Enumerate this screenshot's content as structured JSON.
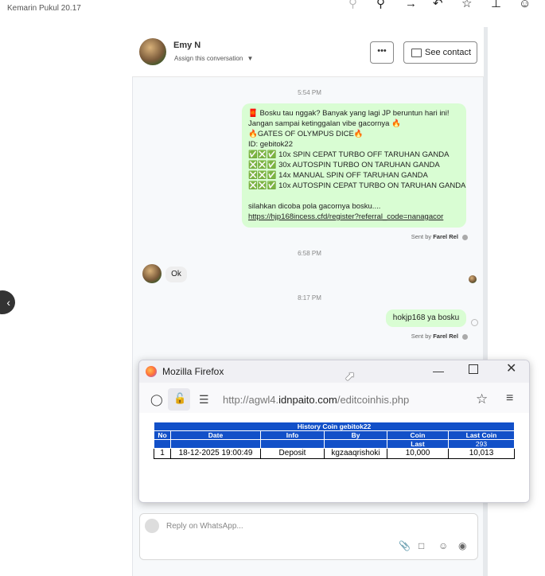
{
  "top_bar": {
    "timestamp": "Kemarin Pukul 20.17",
    "icons": [
      "zoom-out-icon",
      "zoom-in-icon",
      "forward-icon",
      "reply-icon",
      "star-icon",
      "pin-icon",
      "emoji-icon"
    ]
  },
  "conversation_header": {
    "contact_name": "Emy N",
    "assign_label": "Assign this conversation",
    "more_label": "•••",
    "see_contact_label": "See contact"
  },
  "messages": {
    "time1": "5:54 PM",
    "promo": {
      "lines": [
        "🧧 Bosku tau nggak? Banyak yang lagi JP beruntun hari ini!",
        "Jangan sampai ketinggalan vibe gacornya 🔥",
        "🔥GATES OF OLYMPUS DICE🔥",
        "ID: gebitok22",
        "✅❎✅ 10x SPIN CEPAT TURBO OFF TARUHAN GANDA",
        "❎❎✅ 30x AUTOSPIN TURBO ON TARUHAN GANDA",
        "❎❎✅ 14x MANUAL SPIN OFF TARUHAN GANDA",
        "❎❎✅ 10x AUTOSPIN CEPAT TURBO ON TARUHAN GANDA",
        "",
        "silahkan dicoba pola gacornya bosku....",
        "https://hjp168incess.cfd/register?referral_code=nanagacor"
      ],
      "sent_prefix": "Sent by",
      "sent_by": "Farel Rel"
    },
    "time2": "6:58 PM",
    "incoming": "Ok",
    "time3": "8:17 PM",
    "outgoing2": "hokjp168 ya bosku",
    "sent2_prefix": "Sent by",
    "sent2_by": "Farel Rel"
  },
  "firefox": {
    "window_title": "Mozilla Firefox",
    "url_prefix": "http://agwl4.",
    "url_domain": "idnpaito.com",
    "url_path": "/editcoinhis.php",
    "table": {
      "title": "History Coin gebitok22",
      "headers": [
        "No",
        "Date",
        "Info",
        "By",
        "Coin",
        "Last Coin"
      ],
      "subheaders": [
        "Last",
        "293"
      ],
      "rows": [
        [
          "1",
          "18-12-2025 19:00:49",
          "Deposit",
          "kgzaaqrishoki",
          "10,000",
          "10,013"
        ]
      ]
    }
  },
  "reply": {
    "placeholder": "Reply on WhatsApp..."
  }
}
